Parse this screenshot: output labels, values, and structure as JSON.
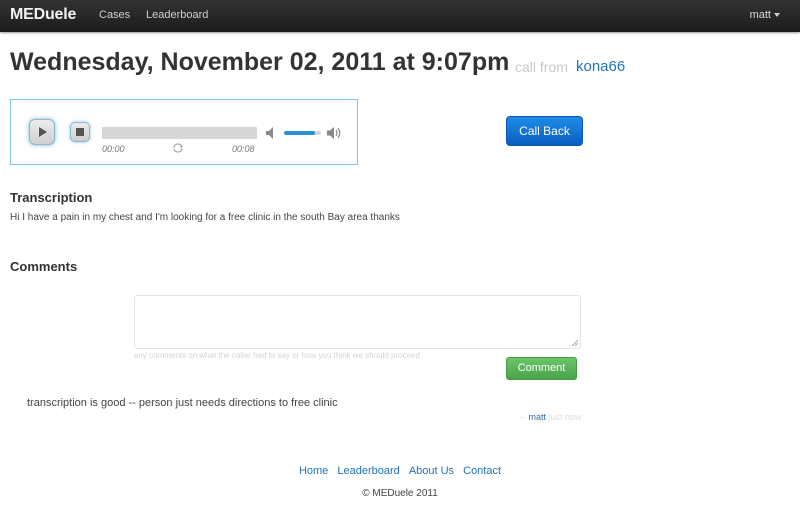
{
  "nav": {
    "brand": "MEDuele",
    "cases": "Cases",
    "leaderboard": "Leaderboard",
    "user": "matt"
  },
  "call": {
    "title": "Wednesday, November 02, 2011 at 9:07pm",
    "from_label": "call from",
    "caller": "kona66",
    "call_back_label": "Call Back"
  },
  "player": {
    "current_time": "00:00",
    "duration": "00:08",
    "progress": 0,
    "volume": 0.85,
    "icons": [
      "play-icon",
      "stop-icon",
      "loop-icon",
      "volume-mute-icon",
      "volume-max-icon"
    ]
  },
  "transcription": {
    "heading": "Transcription",
    "text": "Hi I have a pain in my chest and I'm looking for a free clinic in the south Bay area thanks"
  },
  "comments": {
    "heading": "Comments",
    "input_value": "",
    "help_text": "any comments on what the caller had to say or how you think we should proceed",
    "submit_label": "Comment",
    "items": [
      {
        "text": "transcription is good -- person just needs directions to free clinic",
        "dash": "--",
        "author": "matt",
        "time": "just now"
      }
    ]
  },
  "footer": {
    "links": [
      "Home",
      "Leaderboard",
      "About Us",
      "Contact"
    ],
    "copyright": "© MEDuele 2011"
  },
  "colors": {
    "navbar": "#222222",
    "link": "#1f74b8",
    "primary_button": "#0a6ed1",
    "success_button": "#5bb75b",
    "player_border": "#7fc6de"
  }
}
